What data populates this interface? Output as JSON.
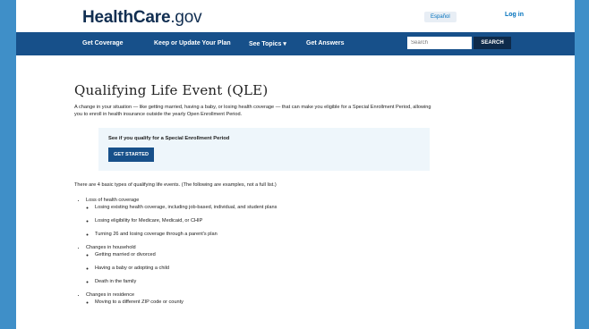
{
  "header": {
    "logo_main": "HealthCare",
    "logo_suffix": ".gov",
    "espanol_label": "Español",
    "login_label": "Log in"
  },
  "nav": {
    "items": [
      {
        "label": "Get Coverage"
      },
      {
        "label": "Keep or Update Your Plan"
      },
      {
        "label": "See Topics  ▾"
      },
      {
        "label": "Get Answers"
      }
    ],
    "search_placeholder": "Search",
    "search_button": "SEARCH"
  },
  "main": {
    "title": "Qualifying Life Event (QLE)",
    "intro": "A change in your situation — like getting married, having a baby, or losing health coverage — that can make you eligible for a Special Enrollment Period, allowing you to enroll in health insurance outside the yearly Open Enrollment Period.",
    "qle_box_title": "See if you qualify for a Special Enrollment Period",
    "start_button": "GET STARTED",
    "lead": "There are 4 basic types of qualifying life events. (The following are examples, not a full list.)",
    "categories": [
      {
        "label": "Loss of health coverage",
        "items": [
          "Losing existing health coverage, including job-based, individual, and student plans",
          "Losing eligibility for Medicare, Medicaid, or CHIP",
          "Turning 26 and losing coverage through a parent's plan"
        ]
      },
      {
        "label": "Changes in household",
        "items": [
          "Getting married or divorced",
          "Having a baby or adopting a child",
          "Death in the family"
        ]
      },
      {
        "label": "Changes in residence",
        "items": [
          "Moving to a different ZIP code or county"
        ]
      }
    ]
  },
  "colors": {
    "frame_background": "#3f8fc8",
    "nav_background": "#17508a",
    "button_background": "#17508a",
    "box_background": "#eef6fb"
  }
}
